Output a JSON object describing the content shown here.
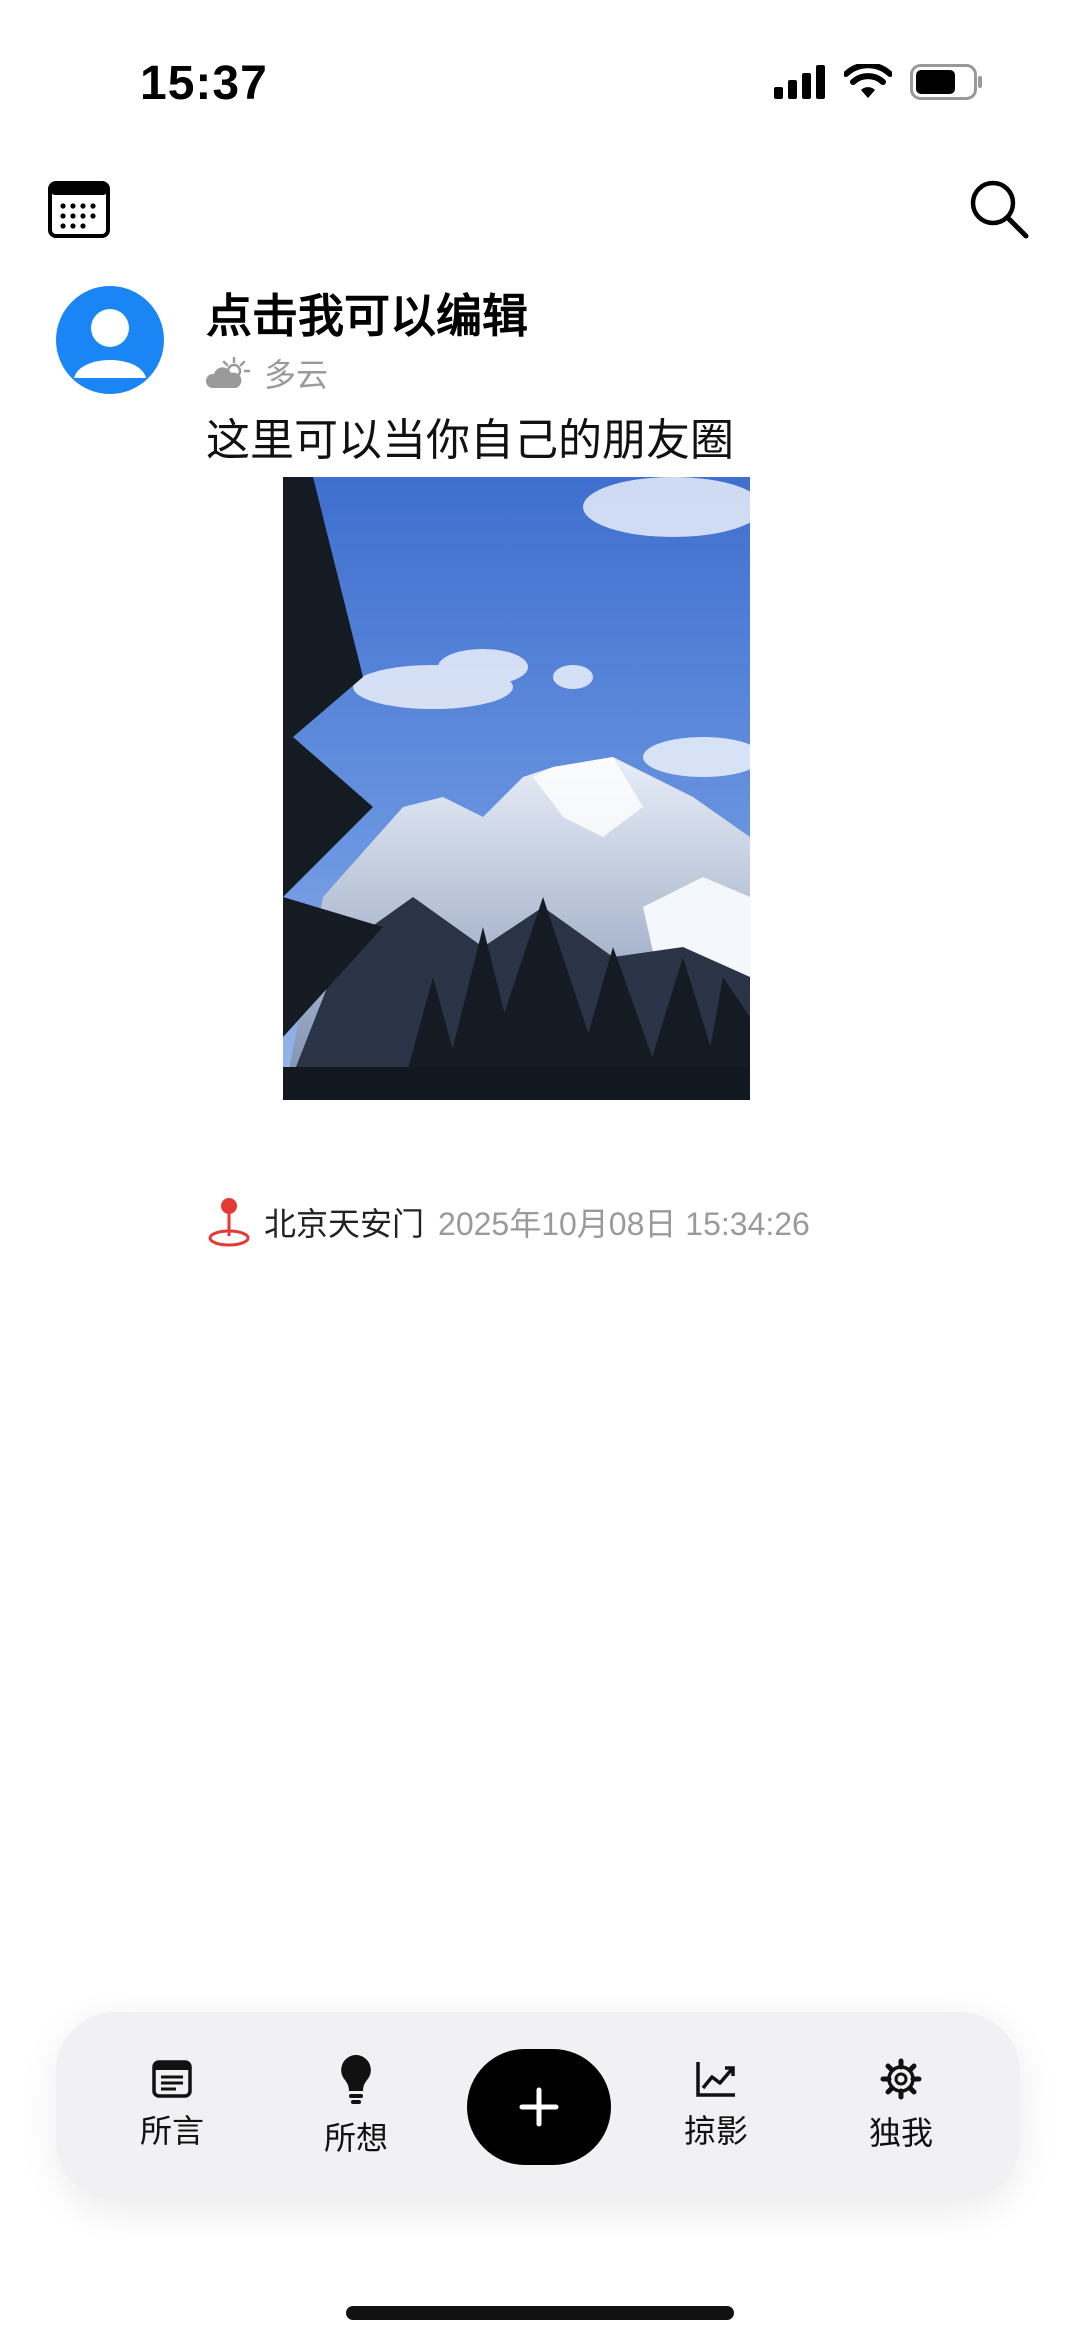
{
  "status_bar": {
    "time": "15:37",
    "battery_level": 0.7
  },
  "post": {
    "title": "点击我可以编辑",
    "weather": "多云",
    "text": "这里可以当你自己的朋友圈",
    "location": "北京天安门",
    "datetime": "2025年10月08日 15:34:26"
  },
  "tabbar": {
    "tabs": [
      {
        "label": "所言",
        "icon": "document-icon"
      },
      {
        "label": "所想",
        "icon": "lightbulb-icon"
      },
      {
        "label": "掠影",
        "icon": "chart-line-icon"
      },
      {
        "label": "独我",
        "icon": "gear-icon"
      }
    ],
    "add_icon": "plus-icon"
  },
  "colors": {
    "accent": "#1a86f5",
    "location_pin": "#e53935",
    "muted_text": "#9a9a9a",
    "tabbar_bg": "#f1f1f4"
  }
}
